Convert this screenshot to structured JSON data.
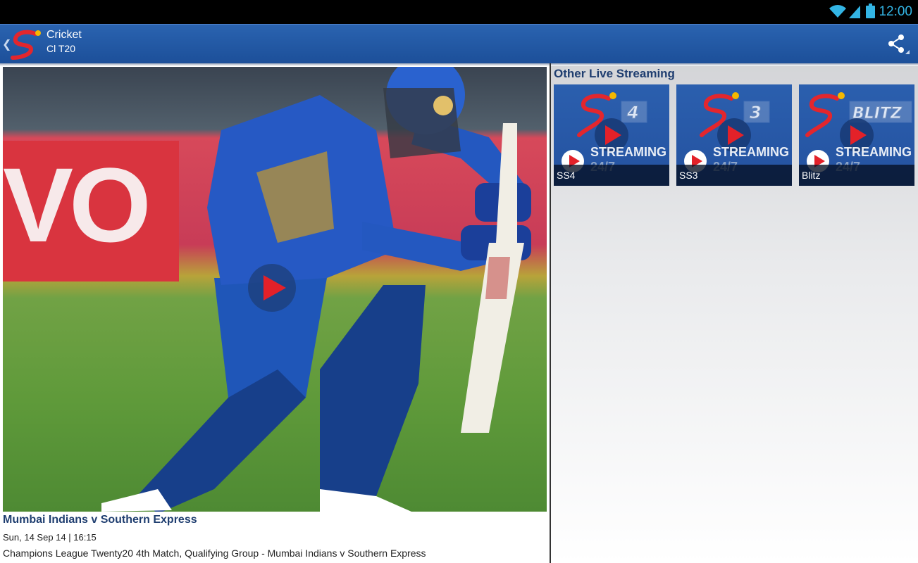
{
  "status_bar": {
    "time": "12:00",
    "icons": [
      "wifi-icon",
      "signal-icon",
      "battery-icon"
    ],
    "accent_color": "#33b5e5"
  },
  "action_bar": {
    "title": "Cricket",
    "subtitle": "Cl T20",
    "up_icon": "chevron-left-icon",
    "share_icon": "share-icon",
    "background_color": "#2a63b0"
  },
  "featured": {
    "match_title": "Mumbai Indians v Southern Express",
    "date_time": "Sun, 14 Sep 14 | 16:15",
    "description": "Champions League Twenty20 4th Match, Qualifying Group - Mumbai Indians v Southern Express",
    "image_alt": "Batsman in blue kit playing a defensive shot",
    "banner_text": "VO"
  },
  "other_streams": {
    "heading": "Other Live Streaming",
    "channels": [
      {
        "label": "SS4",
        "badge": "4",
        "streaming": "STREAMING",
        "hours": "24/7"
      },
      {
        "label": "SS3",
        "badge": "3",
        "streaming": "STREAMING",
        "hours": "24/7"
      },
      {
        "label": "Blitz",
        "badge": "BLITZ",
        "streaming": "STREAMING",
        "hours": "24/7"
      }
    ]
  },
  "colors": {
    "heading_text": "#1f3e70",
    "play_red": "#e32129",
    "channel_card": "#2b5fae"
  }
}
